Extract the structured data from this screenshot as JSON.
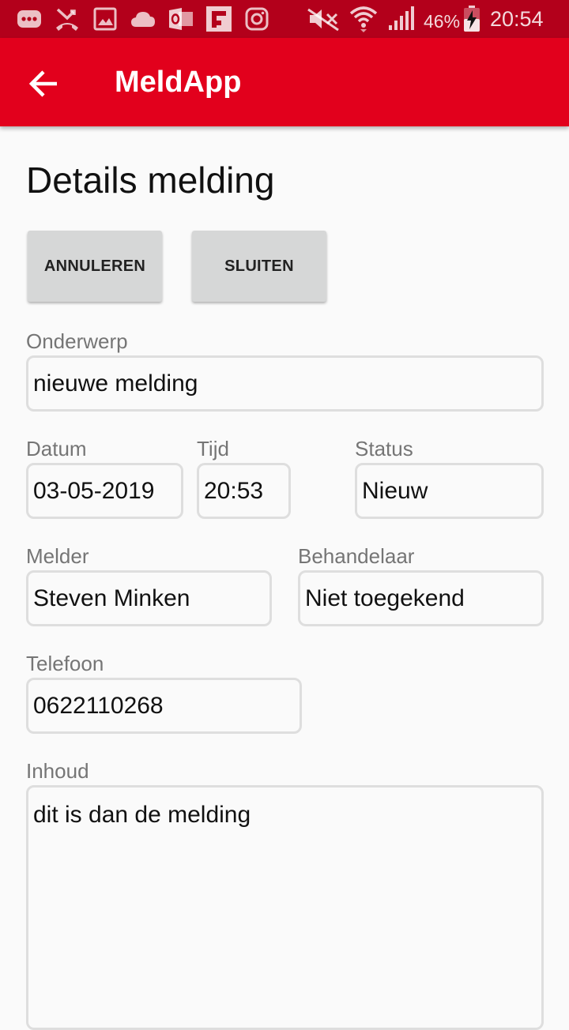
{
  "status_bar": {
    "battery": "46%",
    "time": "20:54",
    "icons": [
      "message-icon",
      "missed-call-icon",
      "gallery-icon",
      "cloud-icon",
      "outlook-icon",
      "flipboard-icon",
      "instagram-icon",
      "mute-icon",
      "wifi-icon",
      "signal-icon",
      "battery-charging-icon"
    ]
  },
  "app_bar": {
    "title": "MeldApp",
    "back_icon": "arrow-back-icon"
  },
  "page_title": "Details melding",
  "buttons": {
    "cancel": "ANNULEREN",
    "close": "SLUITEN"
  },
  "form": {
    "subject": {
      "label": "Onderwerp",
      "value": "nieuwe melding"
    },
    "date": {
      "label": "Datum",
      "value": "03-05-2019"
    },
    "time": {
      "label": "Tijd",
      "value": "20:53"
    },
    "status": {
      "label": "Status",
      "value": "Nieuw"
    },
    "reporter": {
      "label": "Melder",
      "value": "Steven Minken"
    },
    "handler": {
      "label": "Behandelaar",
      "value": "Niet toegekend"
    },
    "phone": {
      "label": "Telefoon",
      "value": "0622110268"
    },
    "content": {
      "label": "Inhoud",
      "value": "dit is dan de melding"
    }
  },
  "colors": {
    "status_bar": "#b3001b",
    "app_bar": "#e2001c",
    "button": "#d6d7d7",
    "field_border": "#dedede"
  }
}
